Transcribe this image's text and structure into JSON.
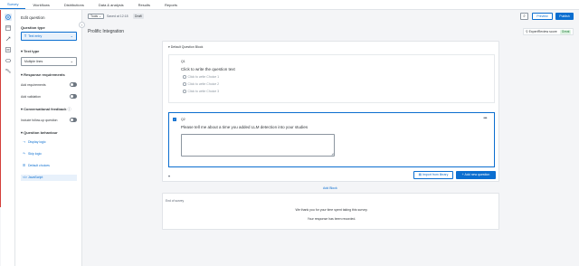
{
  "nav": {
    "tabs": [
      {
        "label": "Survey"
      },
      {
        "label": "Workflows"
      },
      {
        "label": "Distributions"
      },
      {
        "label": "Data & analysis"
      },
      {
        "label": "Results"
      },
      {
        "label": "Reports"
      }
    ],
    "active_tab": "Survey"
  },
  "rail": {
    "icons": [
      "survey-builder-icon",
      "look-and-feel-icon",
      "survey-flow-icon",
      "survey-options-icon",
      "tools-icon",
      "resources-icon"
    ]
  },
  "left_panel": {
    "title": "Edit question",
    "collapse_glyph": "‹",
    "question_type_label": "Question type",
    "question_type_value": "Text entry",
    "question_type_icon": "T",
    "text_type_label": "Text type",
    "text_type_value": "Multiple lines",
    "response_requirements": "Response requirements",
    "add_requirements": "Add requirements",
    "add_validation": "Add validation",
    "conversational_feedback": "Conversational feedback",
    "include_followup": "Include follow-up question",
    "question_behaviour": "Question behaviour",
    "links": [
      {
        "label": "Display logic",
        "icon": "⇢"
      },
      {
        "label": "Skip logic",
        "icon": "↷"
      },
      {
        "label": "Default choices",
        "icon": "☰"
      },
      {
        "label": "JavaScript",
        "icon": "</>"
      }
    ]
  },
  "toolbar": {
    "tools_label": "Tools",
    "saved_text": "Saved at 12:18",
    "draft_label": "Draft",
    "preview_label": "Preview",
    "publish_label": "Publish"
  },
  "survey": {
    "title": "Prolific Integration",
    "expert_review_label": "ExpertReview score",
    "expert_review_value": "Great"
  },
  "block": {
    "name": "Default Question Block",
    "collapse_glyph": "▾",
    "q1": {
      "id": "Q1",
      "text": "Click to write the question text",
      "choices": [
        "Click to write Choice 1",
        "Click to write Choice 2",
        "Click to write Choice 3"
      ]
    },
    "q2": {
      "id": "Q2",
      "text": "Please tell me about a time you added LLM detection into your studies",
      "menu_glyph": "•••",
      "check_glyph": "✓"
    },
    "footer_glyph": "▾",
    "import_label": "Import from library",
    "add_question_label": "+ Add new question"
  },
  "add_block_label": "Add Block",
  "end_of_survey": {
    "label": "End of survey",
    "message1": "We thank you for your time spent taking this survey.",
    "message2": "Your response has been recorded."
  }
}
